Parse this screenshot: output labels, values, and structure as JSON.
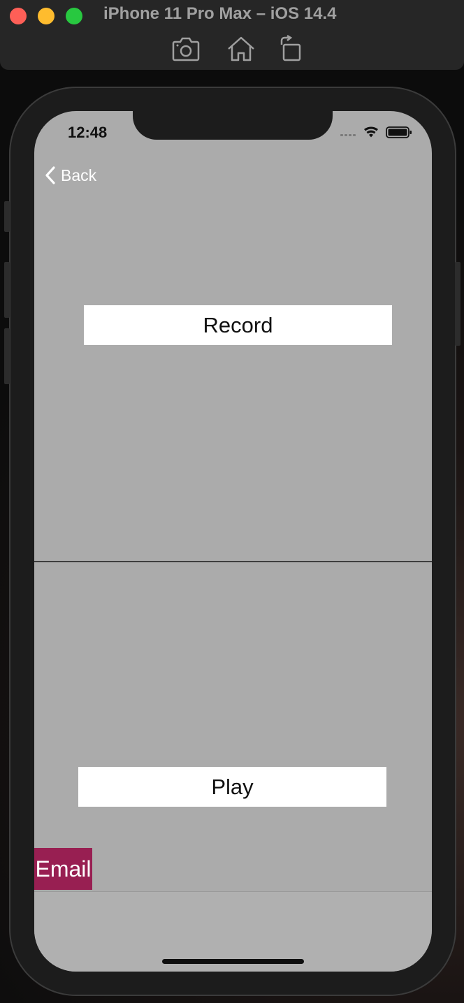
{
  "window": {
    "title": "iPhone 11 Pro Max – iOS 14.4",
    "toolbar_icons": [
      "camera-icon",
      "home-icon",
      "rotate-icon"
    ],
    "traffic_lights": {
      "close": "#fe5f57",
      "minimize": "#febc2e",
      "zoom": "#28c840"
    }
  },
  "status_bar": {
    "time": "12:48",
    "icons": [
      "cellular-icon",
      "wifi-icon",
      "battery-icon"
    ]
  },
  "nav": {
    "back_label": "Back"
  },
  "main": {
    "record_label": "Record",
    "play_label": "Play",
    "email_label": "Email"
  },
  "waveform": {
    "gradient_colors": [
      "#e8304a",
      "#e040d0",
      "#a040e8",
      "#4060e8",
      "#40c8c8",
      "#30d060",
      "#d0e040",
      "#e0a030",
      "#e83020"
    ]
  },
  "colors": {
    "screen_bg": "#ababab",
    "email_button": "#981f52"
  }
}
